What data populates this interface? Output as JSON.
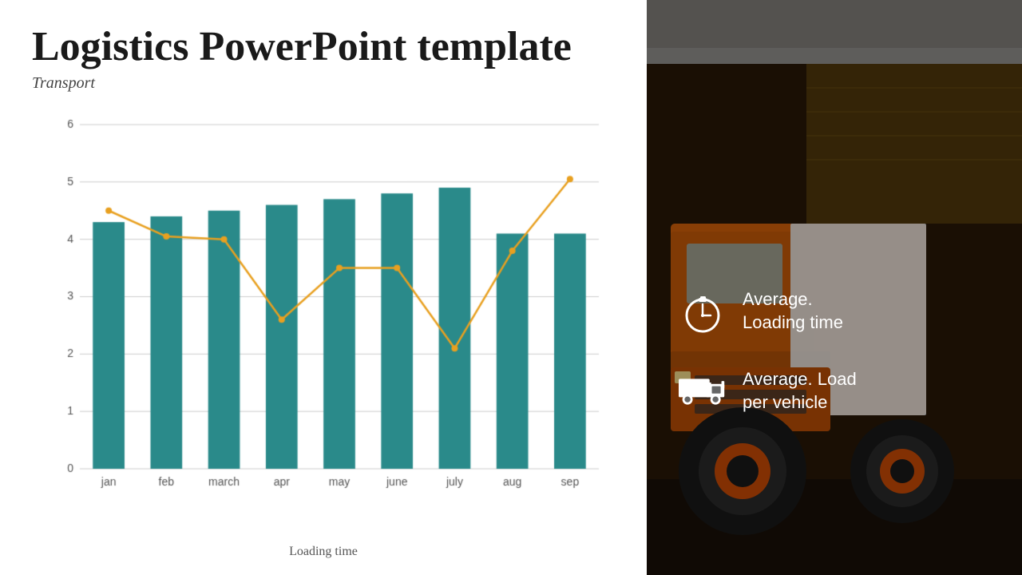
{
  "left": {
    "title": "Logistics PowerPoint template",
    "subtitle": "Transport",
    "x_axis_label": "Loading time",
    "months": [
      "jan",
      "feb",
      "march",
      "apr",
      "may",
      "june",
      "july",
      "aug",
      "sep"
    ],
    "bar_values": [
      4.3,
      4.4,
      4.5,
      4.6,
      4.7,
      4.8,
      4.9,
      4.1,
      4.1
    ],
    "line_values": [
      4.5,
      4.05,
      4.0,
      2.6,
      3.5,
      3.5,
      2.1,
      3.8,
      5.05
    ],
    "y_max": 6,
    "y_ticks": [
      0,
      1,
      2,
      3,
      4,
      5,
      6
    ],
    "bar_color": "#2a8a8a",
    "line_color": "#e8a020"
  },
  "right": {
    "info_items": [
      {
        "icon": "stopwatch",
        "text_line1": "Average.",
        "text_line2": "Loading time"
      },
      {
        "icon": "truck",
        "text_line1": "Average. Load",
        "text_line2": "per vehicle"
      }
    ]
  }
}
